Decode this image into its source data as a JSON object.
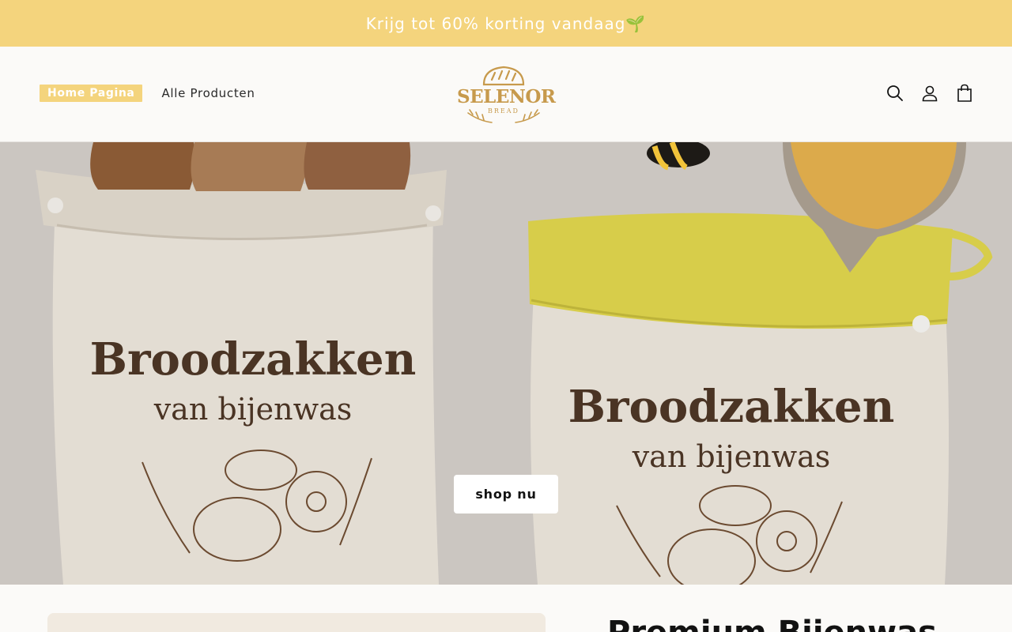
{
  "announcement": {
    "text": "Krijg tot 60% korting vandaag🌱"
  },
  "nav": {
    "home": "Home Pagina",
    "all_products": "Alle Producten"
  },
  "logo": {
    "brand": "SELENOR",
    "sub": "BREAD"
  },
  "hero": {
    "bag_left": {
      "line1": "Broodzakken",
      "line2": "van bijenwas"
    },
    "bag_right": {
      "line1": "Broodzakken",
      "line2": "van bijenwas"
    },
    "cta": "shop nu"
  },
  "section": {
    "title": "Premium Bijenwas"
  },
  "colors": {
    "accent": "#f4d47d",
    "logo": "#c79a4c",
    "hero_bg": "#cbc6c1"
  },
  "icons": [
    "search-icon",
    "account-icon",
    "cart-icon"
  ]
}
